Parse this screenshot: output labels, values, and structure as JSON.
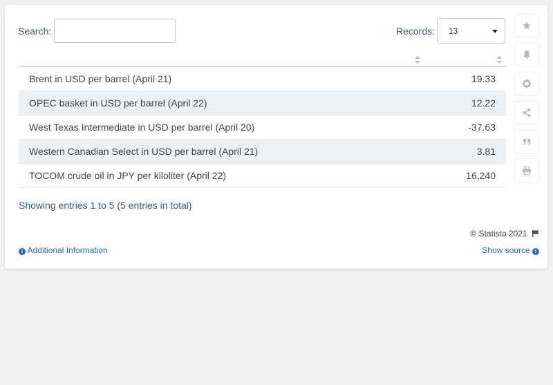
{
  "search": {
    "label": "Search:",
    "value": "",
    "placeholder": ""
  },
  "records": {
    "label": "Records:",
    "value": "13"
  },
  "table": {
    "rows": [
      {
        "label": "Brent in USD per barrel (April 21)",
        "value": "19.33"
      },
      {
        "label": "OPEC basket in USD per barrel (April 22)",
        "value": "12.22"
      },
      {
        "label": "West Texas Intermediate in USD per barrel (April 20)",
        "value": "-37.63"
      },
      {
        "label": "Western Canadian Select in USD per barrel (April 21)",
        "value": "3.81"
      },
      {
        "label": "TOCOM crude oil in JPY per kiloliter (April 22)",
        "value": "16,240"
      }
    ]
  },
  "footer": {
    "entries": "Showing entries 1 to 5 (5 entries in total)",
    "copyright": "© Statista 2021",
    "additional_info": "Additional Information",
    "show_source": "Show source"
  },
  "sidebar": {
    "icons": [
      "star-icon",
      "bell-icon",
      "gear-icon",
      "share-icon",
      "quote-icon",
      "print-icon"
    ]
  },
  "colors": {
    "accent": "#1f6ab2",
    "label_blue": "#3b5a78",
    "row_alt": "#ecf0f3",
    "icon_grey": "#b3b9bf"
  }
}
